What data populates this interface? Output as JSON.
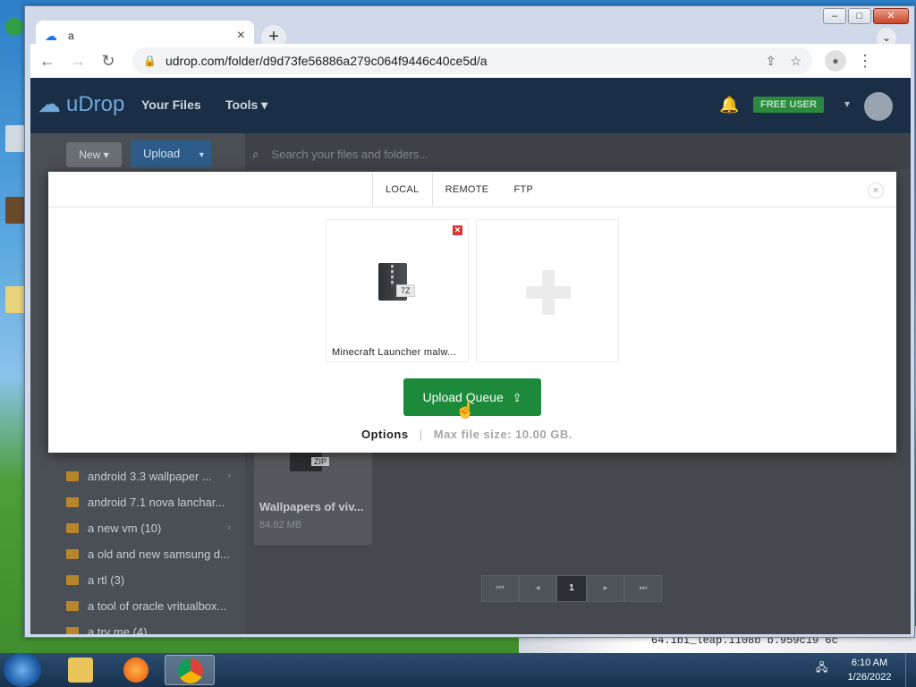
{
  "browser": {
    "tab_title": "a",
    "tab_close": "×",
    "new_tab": "+",
    "url": "udrop.com/folder/d9d73fe56886a279c064f9446c40ce5d/a"
  },
  "site": {
    "brand": "uDrop",
    "nav": {
      "your_files": "Your Files",
      "tools": "Tools ▾"
    },
    "user_badge": "FREE USER",
    "buttons": {
      "new": "New ▾",
      "upload": "Upload"
    },
    "search_placeholder": "Search your files and folders...",
    "folders": [
      {
        "name": "android 3.3 wallpaper ...",
        "has_children": true
      },
      {
        "name": "android 7.1 nova lanchar...",
        "has_children": false
      },
      {
        "name": "a new vm (10)",
        "has_children": true
      },
      {
        "name": "a old and new samsung d...",
        "has_children": false
      },
      {
        "name": "a rtl (3)",
        "has_children": false
      },
      {
        "name": "a tool of oracle vritualbox...",
        "has_children": false
      },
      {
        "name": "a try me (4)",
        "has_children": false
      }
    ],
    "file_card": {
      "ext": "ZIP",
      "name": "Wallpapers of viv...",
      "size": "84.82 MB"
    },
    "pagination": {
      "first": "⏮",
      "prev": "◂",
      "current": "1",
      "next": "▸",
      "last": "⏭"
    }
  },
  "modal": {
    "tabs": [
      "LOCAL",
      "REMOTE",
      "FTP"
    ],
    "active_tab": "LOCAL",
    "close": "×",
    "queue": [
      {
        "name": "Minecraft Launcher malw...",
        "ext": "7Z"
      }
    ],
    "upload_button": "Upload Queue",
    "options_label": "Options",
    "separator": "|",
    "max_file_size": "Max file size: 10.00 GB."
  },
  "taskbar": {
    "time": "6:10 AM",
    "date": "1/26/2022",
    "background_text": "64.ibi_leap.1108b    b.959c19    6c"
  },
  "colors": {
    "header_bg": "#1a2e45",
    "accent_green": "#1c8a3a",
    "upload_blue": "#2e5c8a",
    "remove_red": "#d9312b"
  }
}
